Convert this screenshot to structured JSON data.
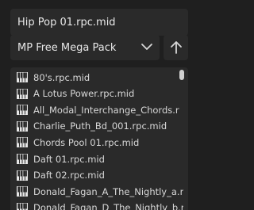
{
  "file_name": "Hip Pop 01.rpc.mid",
  "pack_select": {
    "selected": "MP Free Mega Pack"
  },
  "files": [
    "80's.rpc.mid",
    "A Lotus Power.rpc.mid",
    "All_Modal_Interchange_Chords.r",
    "Charlie_Puth_Bd_001.rpc.mid",
    "Chords Pool 01.rpc.mid",
    "Daft 01.rpc.mid",
    "Daft 02.rpc.mid",
    "Donald_Fagan_A_The_Nightly_a.r",
    "Donald_Fagan_D_The_Nightly_b.r"
  ],
  "icons": {
    "file": "piano-keys-icon",
    "dropdown": "chevron-down-icon",
    "up": "arrow-up-icon"
  },
  "colors": {
    "background": "#1f1f1f",
    "field": "#2a2a2a",
    "text": "#d9d9d9"
  }
}
